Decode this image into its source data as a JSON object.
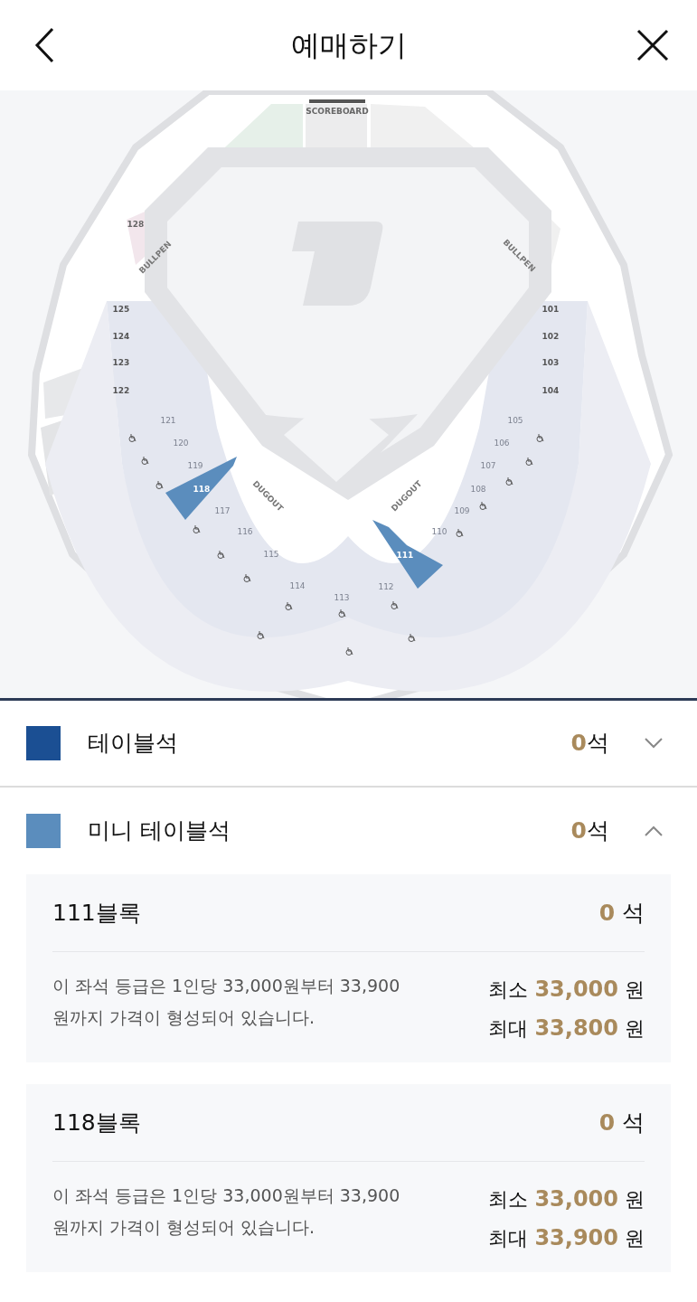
{
  "header": {
    "title": "예매하기"
  },
  "map": {
    "scoreboard": "SCOREBOARD",
    "bullpens": [
      "BULLPEN",
      "BULLPEN"
    ],
    "dugouts": [
      "DUGOUT",
      "DUGOUT"
    ],
    "outfield_label": "128",
    "line_sections": [
      "125",
      "124",
      "123",
      "122",
      "101",
      "102",
      "103",
      "104"
    ],
    "sections": [
      {
        "label": "121",
        "highlighted": false
      },
      {
        "label": "120",
        "highlighted": false
      },
      {
        "label": "119",
        "highlighted": false
      },
      {
        "label": "118",
        "highlighted": true
      },
      {
        "label": "117",
        "highlighted": false
      },
      {
        "label": "116",
        "highlighted": false
      },
      {
        "label": "115",
        "highlighted": false
      },
      {
        "label": "114",
        "highlighted": false
      },
      {
        "label": "113",
        "highlighted": false
      },
      {
        "label": "112",
        "highlighted": false
      },
      {
        "label": "111",
        "highlighted": true
      },
      {
        "label": "110",
        "highlighted": false
      },
      {
        "label": "109",
        "highlighted": false
      },
      {
        "label": "108",
        "highlighted": false
      },
      {
        "label": "107",
        "highlighted": false
      },
      {
        "label": "106",
        "highlighted": false
      },
      {
        "label": "105",
        "highlighted": false
      }
    ]
  },
  "categories": [
    {
      "name": "테이블석",
      "color": "#1b4f93",
      "count": "0",
      "unit": "석",
      "expanded": false
    },
    {
      "name": "미니 테이블석",
      "color": "#5b8dbd",
      "count": "0",
      "unit": "석",
      "expanded": true,
      "blocks": [
        {
          "name": "111블록",
          "count": "0",
          "unit": "석",
          "description": "이 좌석 등급은 1인당 33,000원부터 33,900 원까지 가격이 형성되어 있습니다.",
          "prices": [
            {
              "label": "최소",
              "amount": "33,000",
              "unit": "원"
            },
            {
              "label": "최대",
              "amount": "33,800",
              "unit": "원"
            }
          ]
        },
        {
          "name": "118블록",
          "count": "0",
          "unit": "석",
          "description": "이 좌석 등급은 1인당 33,000원부터 33,900 원까지 가격이 형성되어 있습니다.",
          "prices": [
            {
              "label": "최소",
              "amount": "33,000",
              "unit": "원"
            },
            {
              "label": "최대",
              "amount": "33,900",
              "unit": "원"
            }
          ]
        }
      ]
    }
  ]
}
